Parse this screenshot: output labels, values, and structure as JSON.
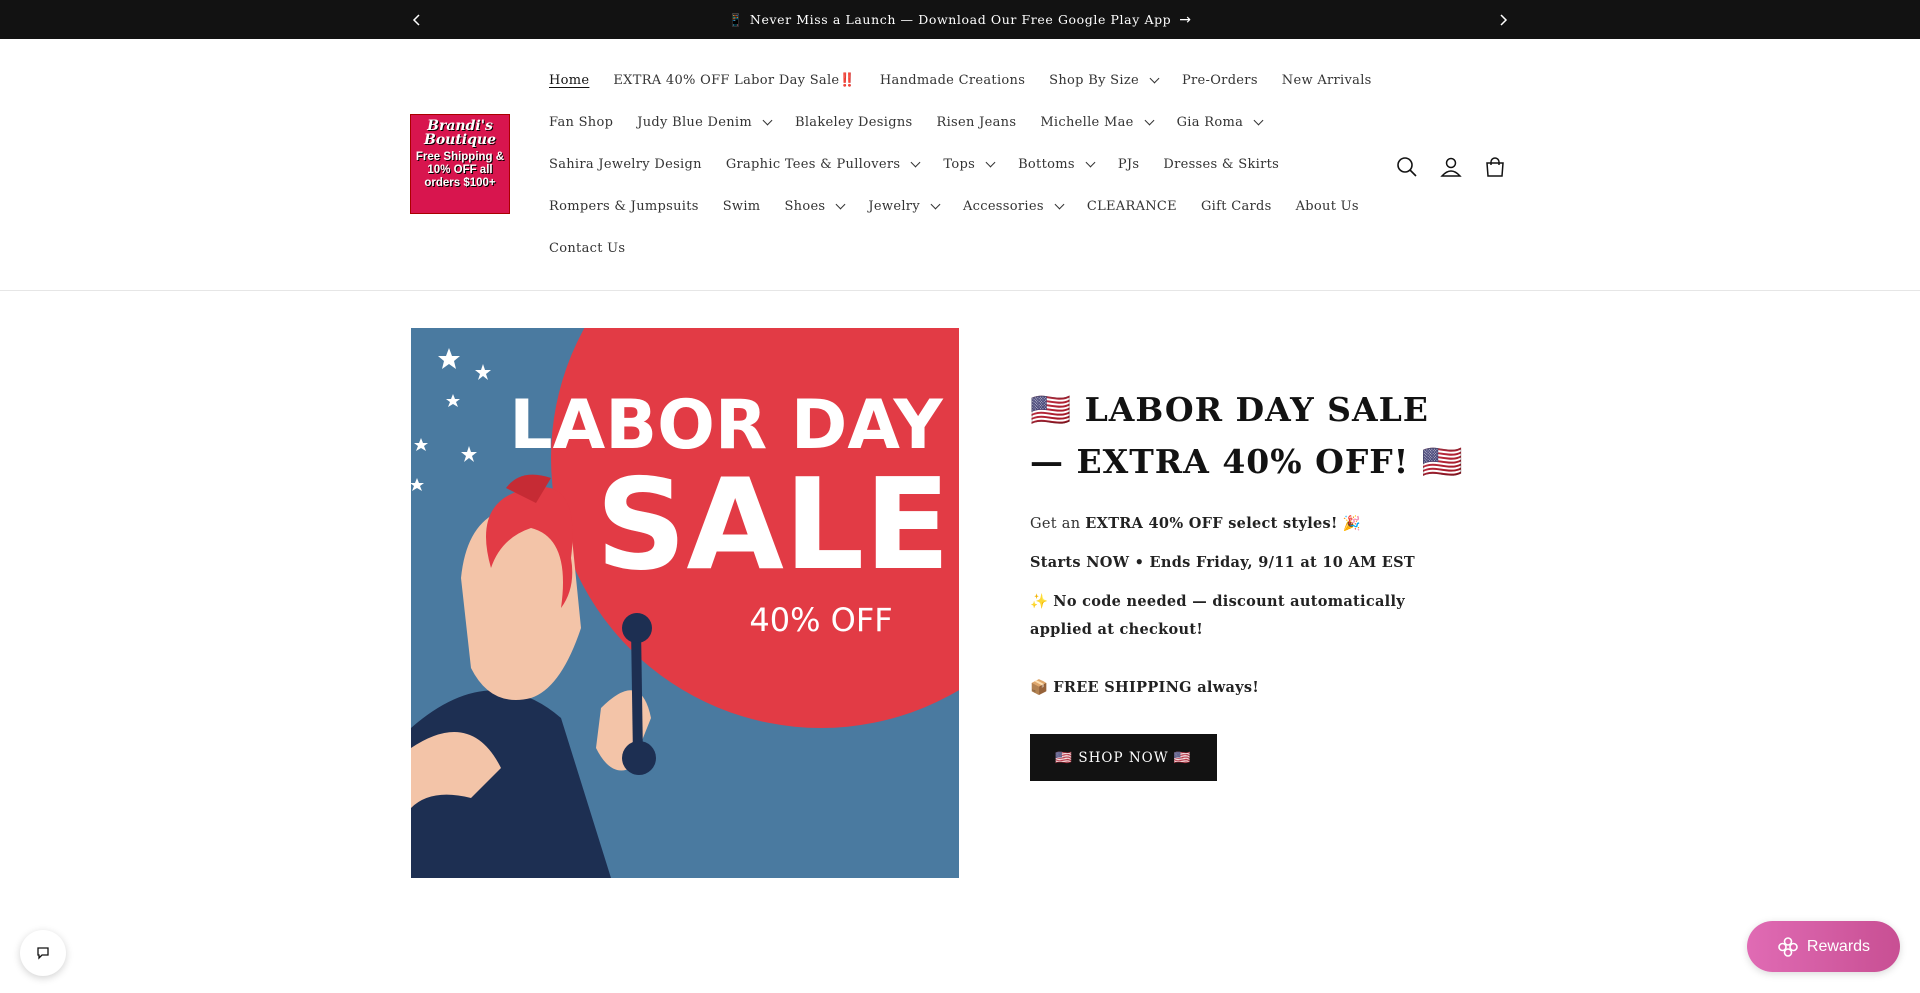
{
  "announcement": {
    "prev_icon": "chevron-left-icon",
    "next_icon": "chevron-right-icon",
    "phone_glyph": "📱",
    "text": "Never Miss a Launch — Download Our Free Google Play App",
    "arrow_glyph": "→"
  },
  "logo": {
    "brand": "Brandi's Boutique",
    "promo": "Free Shipping & 10% OFF all orders $100+"
  },
  "nav": {
    "row1": [
      {
        "label": "Home",
        "active": true,
        "dropdown": false
      },
      {
        "label": "EXTRA 40% OFF Labor Day Sale‼️",
        "dropdown": false
      },
      {
        "label": "Handmade Creations",
        "dropdown": false
      },
      {
        "label": "Shop By Size",
        "dropdown": true
      },
      {
        "label": "Pre-Orders",
        "dropdown": false
      },
      {
        "label": "New Arrivals",
        "dropdown": false
      }
    ],
    "row2": [
      {
        "label": "Fan Shop",
        "dropdown": false
      },
      {
        "label": "Judy Blue Denim",
        "dropdown": true
      },
      {
        "label": "Blakeley Designs",
        "dropdown": false
      },
      {
        "label": "Risen Jeans",
        "dropdown": false
      },
      {
        "label": "Michelle Mae",
        "dropdown": true
      },
      {
        "label": "Gia Roma",
        "dropdown": true
      }
    ],
    "row3": [
      {
        "label": "Sahira Jewelry Design",
        "dropdown": false
      },
      {
        "label": "Graphic Tees & Pullovers",
        "dropdown": true
      },
      {
        "label": "Tops",
        "dropdown": true
      },
      {
        "label": "Bottoms",
        "dropdown": true
      },
      {
        "label": "PJs",
        "dropdown": false
      },
      {
        "label": "Dresses & Skirts",
        "dropdown": false
      }
    ],
    "row4": [
      {
        "label": "Rompers & Jumpsuits",
        "dropdown": false
      },
      {
        "label": "Swim",
        "dropdown": false
      },
      {
        "label": "Shoes",
        "dropdown": true
      },
      {
        "label": "Jewelry",
        "dropdown": true
      },
      {
        "label": "Accessories",
        "dropdown": true
      },
      {
        "label": "CLEARANCE",
        "dropdown": false
      },
      {
        "label": "Gift Cards",
        "dropdown": false
      },
      {
        "label": "About Us",
        "dropdown": false
      }
    ],
    "row5": [
      {
        "label": "Contact Us",
        "dropdown": false
      }
    ]
  },
  "header_icons": [
    "search-icon",
    "account-icon",
    "cart-icon"
  ],
  "hero": {
    "image": {
      "line1": "LABOR DAY",
      "line2": "SALE",
      "line3": "40% OFF"
    },
    "title": "🇺🇸 LABOR DAY SALE — EXTRA 40% OFF! 🇺🇸",
    "p1_prefix": "Get an ",
    "p1_bold": "EXTRA 40% OFF select styles!",
    "p1_suffix": " 🎉",
    "p2": "Starts NOW • Ends Friday, 9/11 at 10 AM EST",
    "p3_prefix": "✨ ",
    "p3_bold": "No code needed — discount automatically applied at checkout!",
    "p4_prefix": "📦 ",
    "p4_bold": "FREE SHIPPING always!",
    "button": "🇺🇸 SHOP NOW 🇺🇸"
  },
  "widgets": {
    "rewards_label": "Rewards",
    "chat_icon": "chat-icon"
  },
  "colors": {
    "announcement_bg": "#121212",
    "hero_blue": "#4a7aa0",
    "hero_red": "#e23b45",
    "rewards_pink": "#d85ea6"
  }
}
